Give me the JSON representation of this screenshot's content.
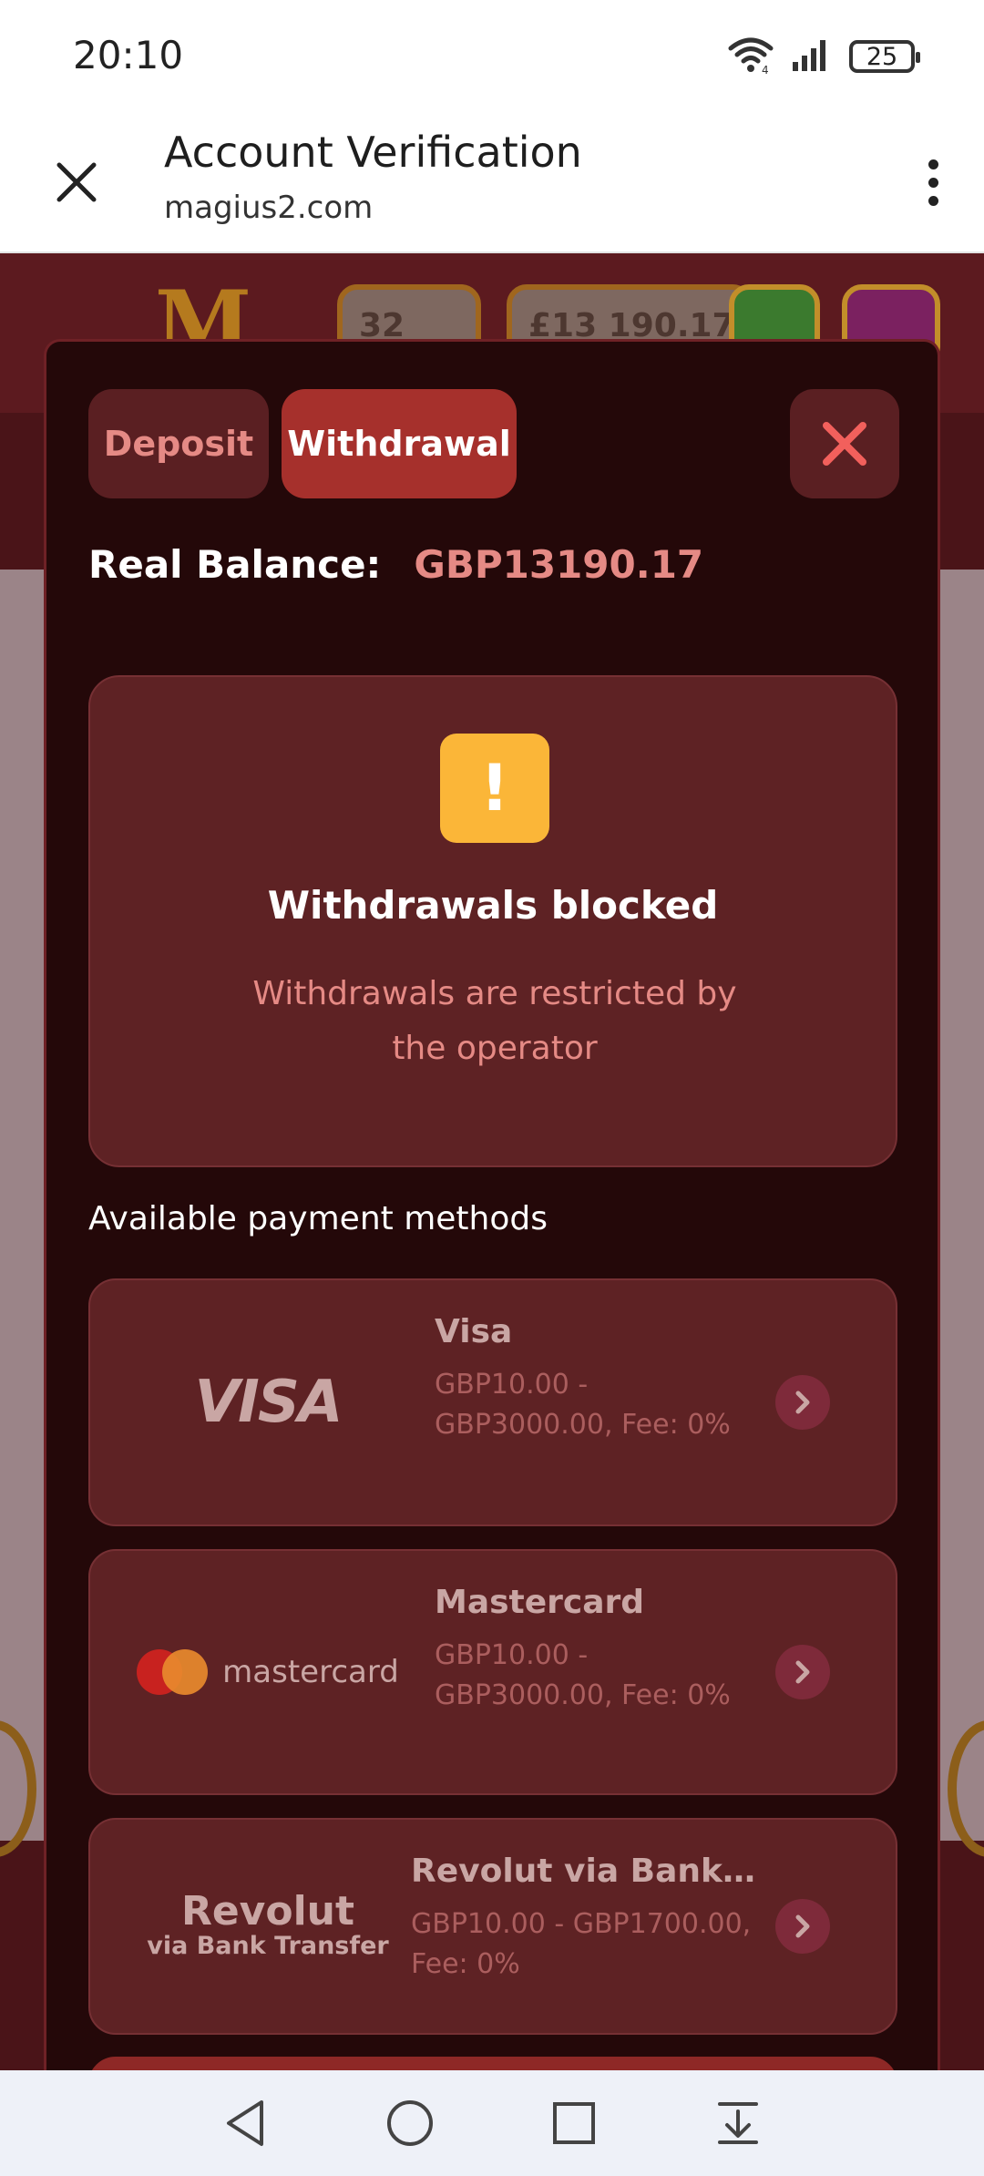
{
  "status_bar": {
    "time": "20:10",
    "battery": "25",
    "icons": [
      "wifi-icon",
      "signal-icon",
      "battery-icon"
    ]
  },
  "browser": {
    "title": "Account Verification",
    "url": "magius2.com",
    "close_icon": "close-icon",
    "menu_icon": "more-vert-icon"
  },
  "background_page": {
    "logo": "M",
    "level": "32",
    "balance": "£13 190.17"
  },
  "modal": {
    "tabs": [
      {
        "label": "Deposit",
        "active": false
      },
      {
        "label": "Withdrawal",
        "active": true
      }
    ],
    "balance_label": "Real Balance:",
    "balance_value": "GBP13190.17",
    "notice": {
      "icon": "!",
      "title": "Withdrawals blocked",
      "description": "Withdrawals are restricted by the operator"
    },
    "methods_title": "Available payment methods",
    "methods": [
      {
        "logo_text": "VISA",
        "name": "Visa",
        "limits": "GBP10.00 - GBP3000.00, Fee: 0%"
      },
      {
        "logo_text": "mastercard",
        "name": "Mastercard",
        "limits": "GBP10.00 - GBP3000.00, Fee: 0%"
      },
      {
        "logo_text": "Revolut",
        "logo_subtext": "via Bank Transfer",
        "name": "Revolut via Bank Tr...",
        "limits": "GBP10.00 - GBP1700.00, Fee: 0%"
      }
    ]
  },
  "colors": {
    "modal_bg": "#240809",
    "card_bg": "#5e2224",
    "accent_red": "#a6302c",
    "text_pink": "#e58a85",
    "warning": "#fbb638"
  }
}
